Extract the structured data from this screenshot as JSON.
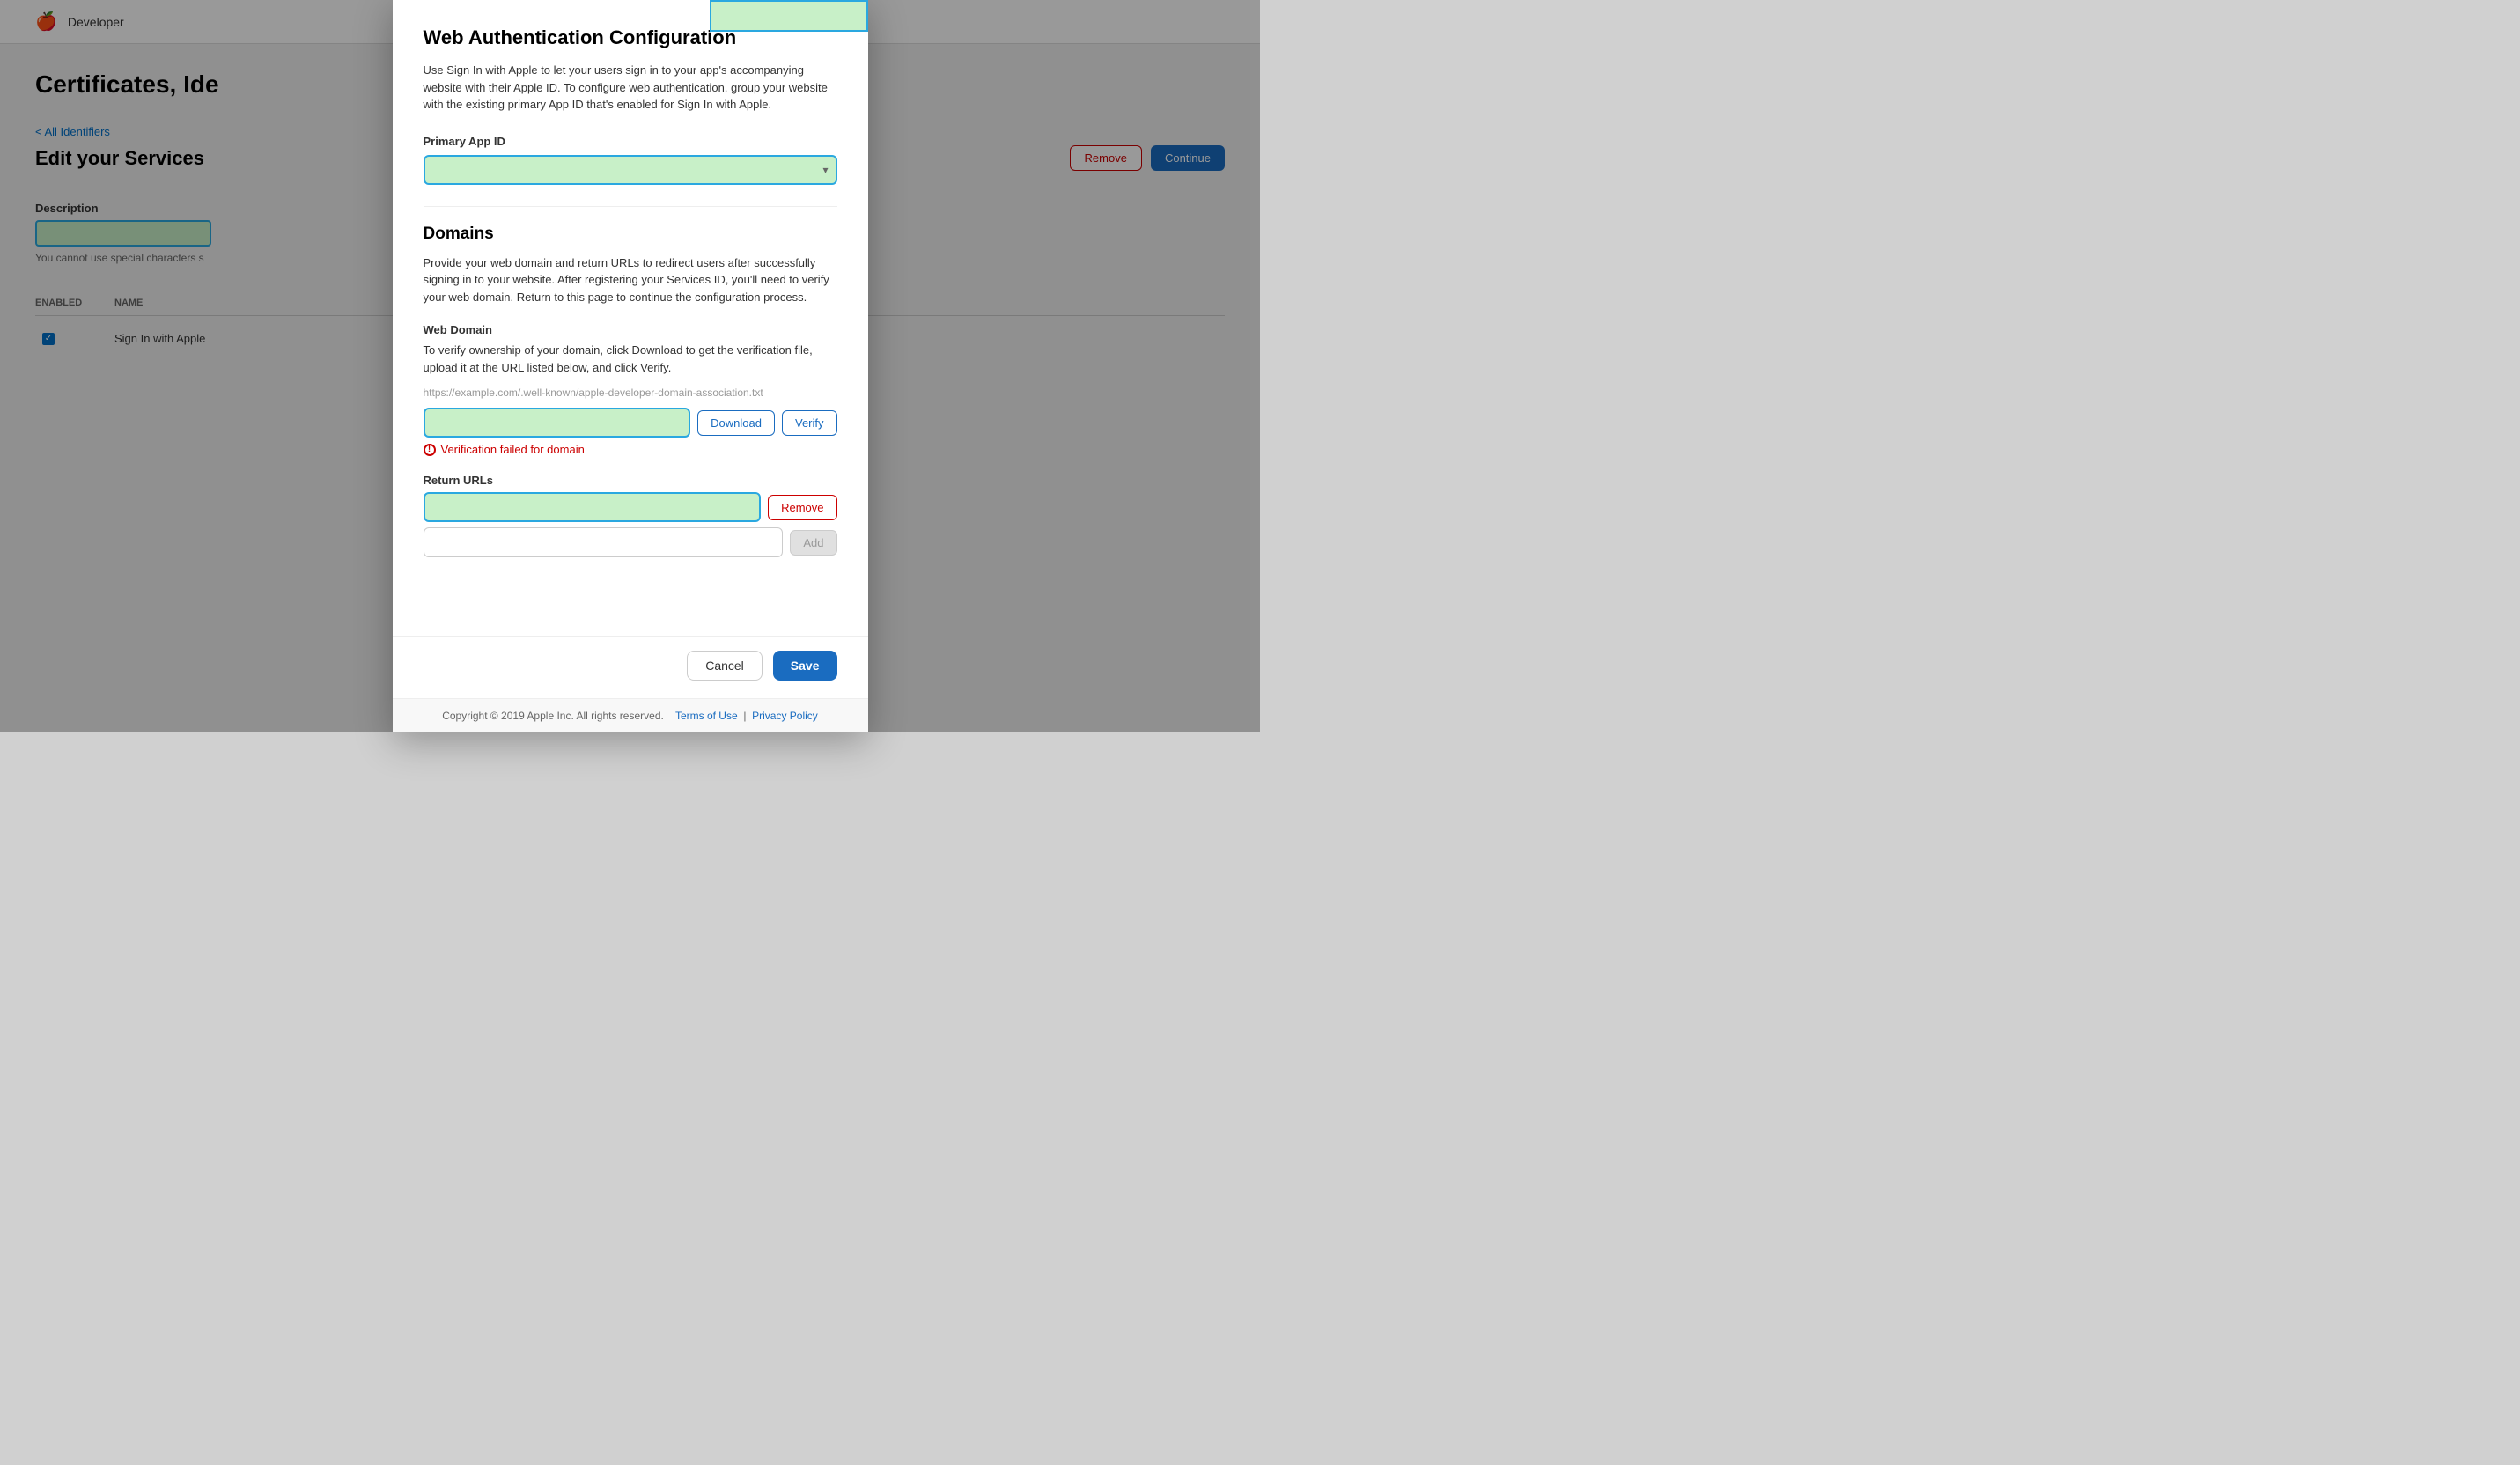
{
  "app": {
    "logo": "🍎",
    "header_title": "Developer"
  },
  "background": {
    "page_title": "Certificates, Ide",
    "back_link": "< All Identifiers",
    "section_title": "Edit your Services",
    "description_label": "Description",
    "description_placeholder": "",
    "helper_text": "You cannot use special characters s",
    "table": {
      "col_enabled": "ENABLED",
      "col_name": "NAME",
      "rows": [
        {
          "enabled": true,
          "name": "Sign In with Apple"
        }
      ]
    },
    "btn_remove": "Remove",
    "btn_continue": "Continue"
  },
  "modal": {
    "title": "Web Authentication Configuration",
    "description": "Use Sign In with Apple to let your users sign in to your app's accompanying website with their Apple ID. To configure web authentication, group your website with the existing primary App ID that's enabled for Sign In with Apple.",
    "primary_app_id": {
      "label": "Primary App ID",
      "placeholder": "",
      "value": ""
    },
    "domains": {
      "heading": "Domains",
      "description": "Provide your web domain and return URLs to redirect users after successfully signing in to your website. After registering your Services ID, you'll need to verify your web domain. Return to this page to continue the configuration process.",
      "web_domain": {
        "label": "Web Domain",
        "description": "To verify ownership of your domain, click Download to get the verification file, upload it at the URL listed below, and click Verify.",
        "url_hint": "https://example.com/.well-known/apple-developer-domain-association.txt",
        "input_value": "",
        "btn_download": "Download",
        "btn_verify": "Verify",
        "error_message": "Verification failed for domain"
      },
      "return_urls": {
        "label": "Return URLs",
        "input_value": "",
        "btn_remove": "Remove",
        "add_input_placeholder": "",
        "btn_add": "Add"
      }
    },
    "footer": {
      "btn_cancel": "Cancel",
      "btn_save": "Save"
    },
    "bottom_footer": {
      "copyright": "Copyright © 2019 Apple Inc. All rights reserved.",
      "terms_link": "Terms of Use",
      "privacy_link": "Privacy Policy"
    }
  }
}
